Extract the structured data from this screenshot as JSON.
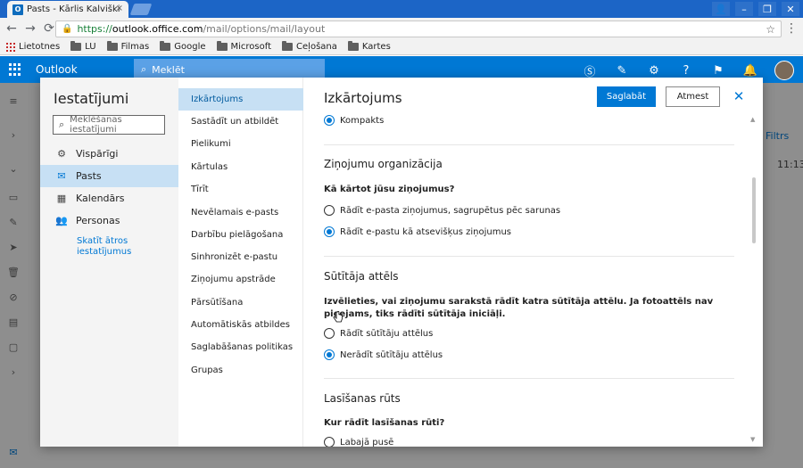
{
  "browser": {
    "tab_title": "Pasts - Kārlis Kalviški",
    "tab_close": "×",
    "window_controls": [
      "👤",
      "–",
      "❐",
      "✕"
    ],
    "url_scheme": "https://",
    "url_host": "outlook.office.com",
    "url_path": "/mail/options/mail/layout",
    "bookmarks": [
      "Lietotnes",
      "LU",
      "Filmas",
      "Google",
      "Microsoft",
      "Ceļošana",
      "Kartes"
    ]
  },
  "outlook": {
    "app_name": "Outlook",
    "search_placeholder": "Meklēt",
    "bg_filter": "Filtrs",
    "bg_time": "11:13"
  },
  "settings": {
    "title": "Iestatījumi",
    "search_placeholder": "Meklēšanas iestatījumi",
    "nav": [
      {
        "label": "Vispārīgi",
        "icon": "gear-icon"
      },
      {
        "label": "Pasts",
        "icon": "mail-icon",
        "selected": true
      },
      {
        "label": "Kalendārs",
        "icon": "calendar-icon"
      },
      {
        "label": "Personas",
        "icon": "people-icon"
      }
    ],
    "quick_link": "Skatīt ātros iestatījumus",
    "subnav": [
      "Izkārtojums",
      "Sastādīt un atbildēt",
      "Pielikumi",
      "Kārtulas",
      "Tīrīt",
      "Nevēlamais e-pasts",
      "Darbību pielāgošana",
      "Sinhronizēt e-pastu",
      "Ziņojumu apstrāde",
      "Pārsūtīšana",
      "Automātiskās atbildes",
      "Saglabāšanas politikas",
      "Grupas"
    ],
    "panel_title": "Izkārtojums",
    "save_label": "Saglabāt",
    "cancel_label": "Atmest",
    "density_option": "Kompakts",
    "org_title": "Ziņojumu organizācija",
    "org_question": "Kā kārtot jūsu ziņojumus?",
    "org_option_1": "Rādīt e-pasta ziņojumus, sagrupētus pēc sarunas",
    "org_option_2": "Rādīt e-pastu kā atsevišķus ziņojumus",
    "sender_title": "Sūtītāja attēls",
    "sender_desc": "Izvēlieties, vai ziņojumu sarakstā rādīt katra sūtītāja attēlu. Ja fotoattēls nav pieejams, tiks rādīti sūtītāja iniciāļi.",
    "sender_option_1": "Rādīt sūtītāju attēlus",
    "sender_option_2": "Nerādīt sūtītāju attēlus",
    "reading_title": "Lasīšanas rūts",
    "reading_question": "Kur rādīt lasīšanas rūti?",
    "reading_option_1": "Labajā pusē"
  },
  "colors": {
    "accent": "#0078d4",
    "selected_bg": "#c7e0f4",
    "chrome": "#1c65c6"
  }
}
